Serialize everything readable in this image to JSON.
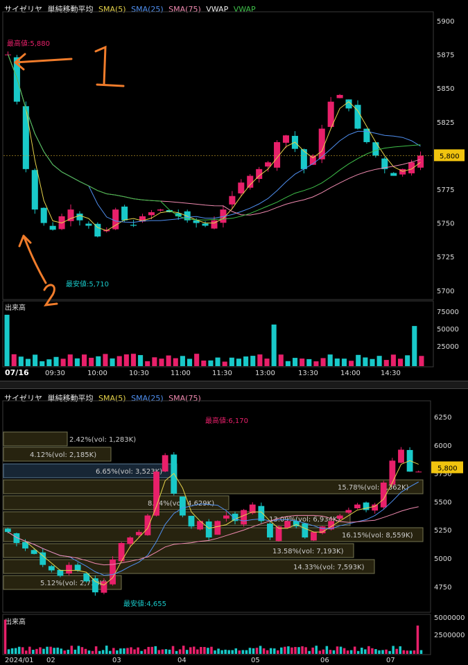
{
  "top": {
    "legend": {
      "name": "サイゼリヤ",
      "indicator": "単純移動平均",
      "sma5": "SMA(5)",
      "sma25": "SMA(25)",
      "sma75": "SMA(75)",
      "vwap1": "VWAP",
      "vwap2": "VWAP"
    },
    "high_label": "最高値:5,880",
    "low_label": "最安値:5,710",
    "price_ticks": [
      "5900",
      "5875",
      "5850",
      "5825",
      "5800",
      "5775",
      "5750",
      "5725",
      "5700"
    ],
    "current_price": "5,800",
    "volume_label": "出来高",
    "volume_ticks": [
      "75000",
      "50000",
      "25000"
    ],
    "date_label": "07/16",
    "time_ticks": [
      "09:30",
      "10:00",
      "10:30",
      "11:00",
      "11:30",
      "13:00",
      "13:30",
      "14:00",
      "14:30"
    ],
    "annotations": [
      "1",
      "2"
    ]
  },
  "bottom": {
    "legend": {
      "name": "サイゼリヤ",
      "indicator": "単純移動平均",
      "sma5": "SMA(5)",
      "sma25": "SMA(25)",
      "sma75": "SMA(75)"
    },
    "high_label": "最高値:6,170",
    "low_label": "最安値:4,655",
    "price_ticks": [
      "6250",
      "6000",
      "5750",
      "5500",
      "5250",
      "5000",
      "4750"
    ],
    "current_price": "5,800",
    "volume_label": "出来高",
    "volume_ticks": [
      "5000000",
      "2500000"
    ],
    "x_ticks": [
      "2024/01",
      "02",
      "03",
      "04",
      "05",
      "06",
      "07"
    ],
    "volume_profile": [
      {
        "label": "2.42%(vol: 1,283K)",
        "pct": 2.42
      },
      {
        "label": "4.12%(vol: 2,185K)",
        "pct": 4.12
      },
      {
        "label": "6.65%(vol: 3,523K)",
        "pct": 6.65
      },
      {
        "label": "15.78%(vol: 8,362K)",
        "pct": 15.78
      },
      {
        "label": "8.74%(vol: 4,629K)",
        "pct": 8.74
      },
      {
        "label": "13.09%(vol: 6,934K)",
        "pct": 13.09
      },
      {
        "label": "16.15%(vol: 8,559K)",
        "pct": 16.15
      },
      {
        "label": "13.58%(vol: 7,193K)",
        "pct": 13.58
      },
      {
        "label": "14.33%(vol: 7,593K)",
        "pct": 14.33
      },
      {
        "label": "5.12%(vol: 2,713K)",
        "pct": 5.12
      }
    ]
  },
  "chart_data": [
    {
      "type": "candlestick",
      "title": "サイゼリヤ 単純移動平均",
      "period": "intraday 07/16",
      "ylim": [
        5700,
        5900
      ],
      "high": 5880,
      "low": 5710,
      "last": 5800,
      "close_path": [
        5875,
        5840,
        5790,
        5760,
        5750,
        5745,
        5755,
        5760,
        5752,
        5748,
        5740,
        5745,
        5760,
        5752,
        5748,
        5755,
        5758,
        5760,
        5758,
        5755,
        5752,
        5750,
        5748,
        5752,
        5760,
        5770,
        5780,
        5785,
        5790,
        5795,
        5810,
        5815,
        5805,
        5790,
        5800,
        5820,
        5840,
        5845,
        5835,
        5820,
        5810,
        5800,
        5790,
        5785,
        5790,
        5795,
        5800
      ],
      "volume_ylim": [
        0,
        75000
      ]
    },
    {
      "type": "candlestick",
      "title": "サイゼリヤ 単純移動平均",
      "period": "daily 2024/01 - 2024/07",
      "ylim": [
        4650,
        6300
      ],
      "high": 6170,
      "low": 4655,
      "last": 5800,
      "close_path": [
        5250,
        5150,
        5100,
        5050,
        4950,
        4900,
        4850,
        4950,
        4900,
        4800,
        4700,
        4800,
        5000,
        5150,
        5200,
        5250,
        5400,
        5800,
        5950,
        5600,
        5400,
        5300,
        5350,
        5200,
        5350,
        5400,
        5350,
        5450,
        5500,
        5350,
        5200,
        5300,
        5350,
        5300,
        5200,
        5250,
        5300,
        5350,
        5400,
        5450,
        5500,
        5450,
        5500,
        5700,
        5900,
        6000,
        5800,
        5800
      ],
      "volume_ylim": [
        0,
        5000000
      ]
    }
  ]
}
